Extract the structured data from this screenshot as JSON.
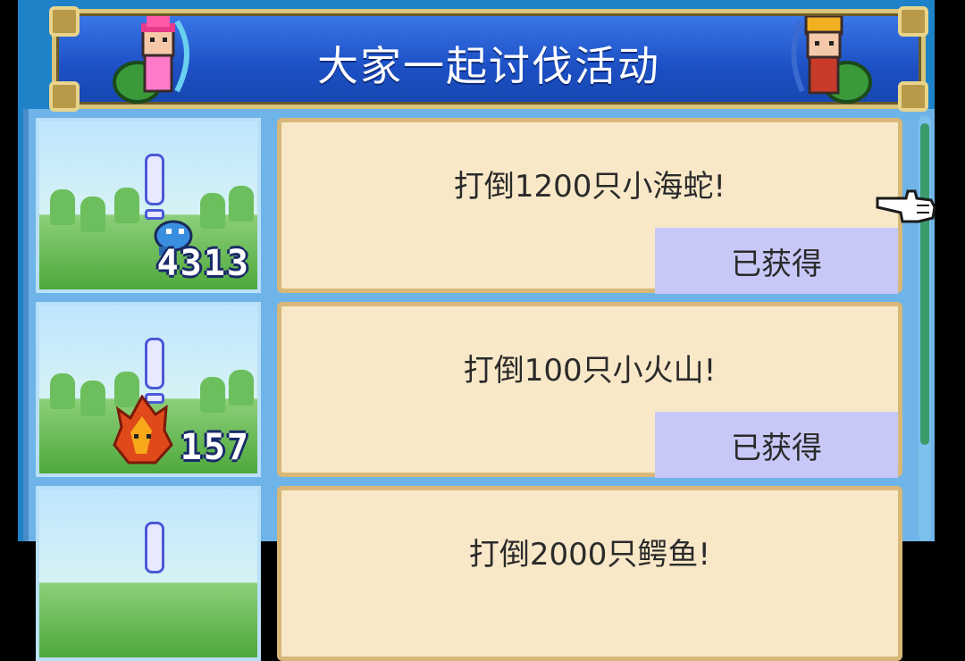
{
  "header": {
    "title": "大家一起讨伐活动"
  },
  "quests": [
    {
      "title": "打倒1200只小海蛇!",
      "count": "4313",
      "status": "已获得",
      "monster_icon": "sea-serpent-icon",
      "monster_color": "#3a8ee0"
    },
    {
      "title": "打倒100只小火山!",
      "count": "157",
      "status": "已获得",
      "monster_icon": "fire-monster-icon",
      "monster_color": "#e04a1a"
    },
    {
      "title": "打倒2000只鳄鱼!",
      "count": "",
      "status": "",
      "monster_icon": "crocodile-icon",
      "monster_color": "#4aa04a"
    }
  ],
  "colors": {
    "accent": "#1c4fc4",
    "card": "#f8e8c8",
    "claim_button": "#c8c8f8",
    "frame": "#1e82c8"
  }
}
